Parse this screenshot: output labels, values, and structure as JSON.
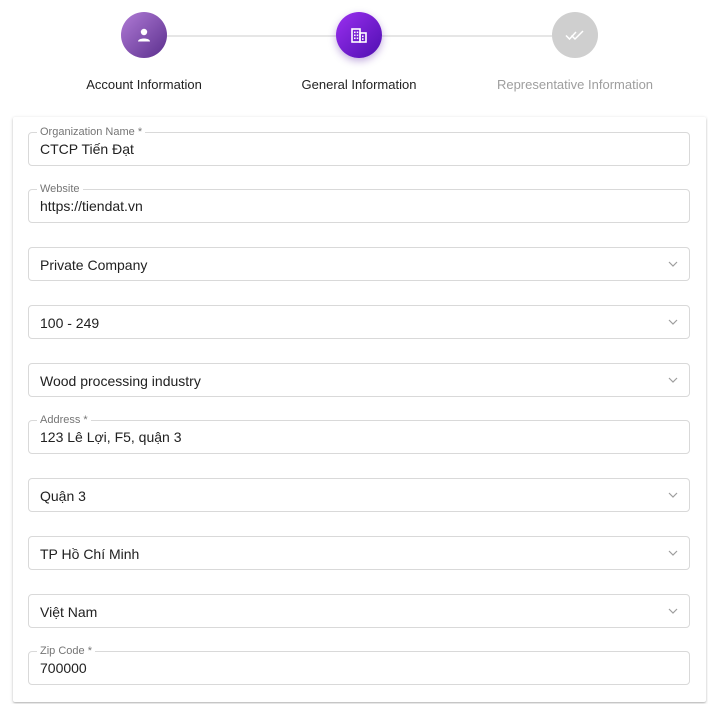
{
  "stepper": {
    "steps": [
      {
        "label": "Account Information",
        "state": "done",
        "icon": "person-icon"
      },
      {
        "label": "General Information",
        "state": "active",
        "icon": "building-icon"
      },
      {
        "label": "Representative Information",
        "state": "pending",
        "icon": "double-check-icon"
      }
    ]
  },
  "form": {
    "organization_name": {
      "label": "Organization Name *",
      "value": "CTCP Tiến Đạt"
    },
    "website": {
      "label": "Website",
      "value": "https://tiendat.vn"
    },
    "company_type": {
      "value": "Private Company"
    },
    "company_size": {
      "value": "100 - 249"
    },
    "industry": {
      "value": "Wood processing industry"
    },
    "address": {
      "label": "Address *",
      "value": "123 Lê Lợi, F5, quận 3"
    },
    "district": {
      "value": "Quận 3"
    },
    "city": {
      "value": "TP Hồ Chí Minh"
    },
    "country": {
      "value": "Việt Nam"
    },
    "zip_code": {
      "label": "Zip Code *",
      "value": "700000"
    }
  },
  "colors": {
    "accent": "#7b1fe0",
    "done": "#8e5cc0",
    "pending": "#cfcfcf",
    "border": "#d9d9d9"
  }
}
